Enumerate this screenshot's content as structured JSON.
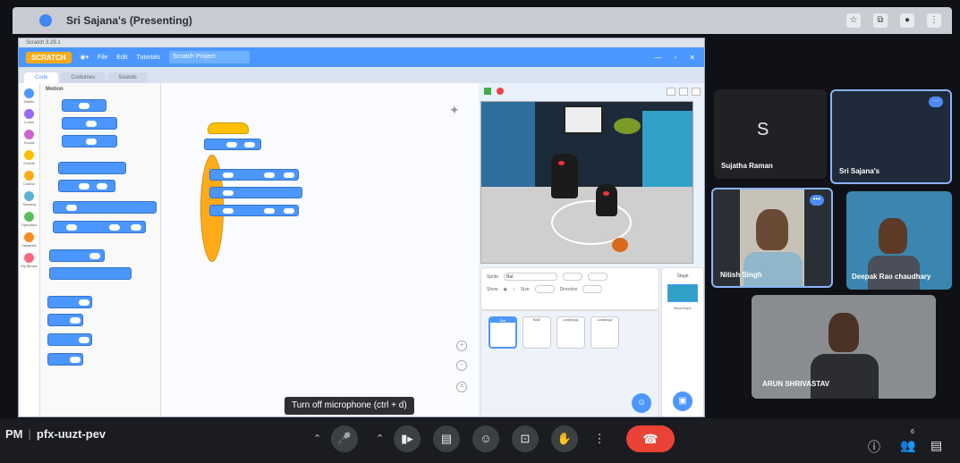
{
  "meet": {
    "title": "Sri Sajana's (Presenting)",
    "meeting_code": "pfx-uuzt-pev",
    "time_suffix": "PM",
    "tooltip": "Turn off microphone (ctrl + d)",
    "participant_count_badge": "6"
  },
  "scratch": {
    "window_title": "Scratch 3.29.1",
    "brand": "SCRATCH",
    "menu": [
      "File",
      "Edit",
      "Tutorials"
    ],
    "project_name": "Scratch Project",
    "tabs": [
      "Code",
      "Costumes",
      "Sounds"
    ],
    "palette_title": "Motion",
    "categories": [
      {
        "label": "Motion",
        "color": "#4c97ff"
      },
      {
        "label": "Looks",
        "color": "#9966ff"
      },
      {
        "label": "Sound",
        "color": "#cf63cf"
      },
      {
        "label": "Events",
        "color": "#ffbf00"
      },
      {
        "label": "Control",
        "color": "#ffab19"
      },
      {
        "label": "Sensing",
        "color": "#5cb1d6"
      },
      {
        "label": "Operators",
        "color": "#59c059"
      },
      {
        "label": "Variables",
        "color": "#ff8c1a"
      },
      {
        "label": "My Blocks",
        "color": "#ff6680"
      }
    ],
    "sprite_label": "Sprite",
    "sprite_name": "Bat",
    "show_label": "Show",
    "size_label": "Size",
    "direction_label": "Direction",
    "sprites": [
      "Bat",
      "Bat2",
      "Ladybug1",
      "Ladybug2"
    ],
    "stage_label": "Stage",
    "backdrops_label": "Backdrops"
  },
  "participants": [
    {
      "name": "Sujatha Raman",
      "initial": "S"
    },
    {
      "name": "Sri Sajana's"
    },
    {
      "name": "Nitish Singh"
    },
    {
      "name": "Deepak Rao chaudhary"
    },
    {
      "name": "ARUN SHRIVASTAV"
    }
  ],
  "icons": {
    "mic": "mic-icon",
    "camera": "camera-icon",
    "captions": "captions-icon",
    "emoji": "emoji-icon",
    "present": "present-icon",
    "hand": "raise-hand-icon",
    "more": "more-icon",
    "end": "end-call-icon",
    "info": "info-icon",
    "people": "people-icon",
    "chat": "chat-icon"
  },
  "colors": {
    "scratch_blue": "#4c97ff",
    "end_call": "#ea4335",
    "active_tile_border": "#8ab4f8"
  }
}
